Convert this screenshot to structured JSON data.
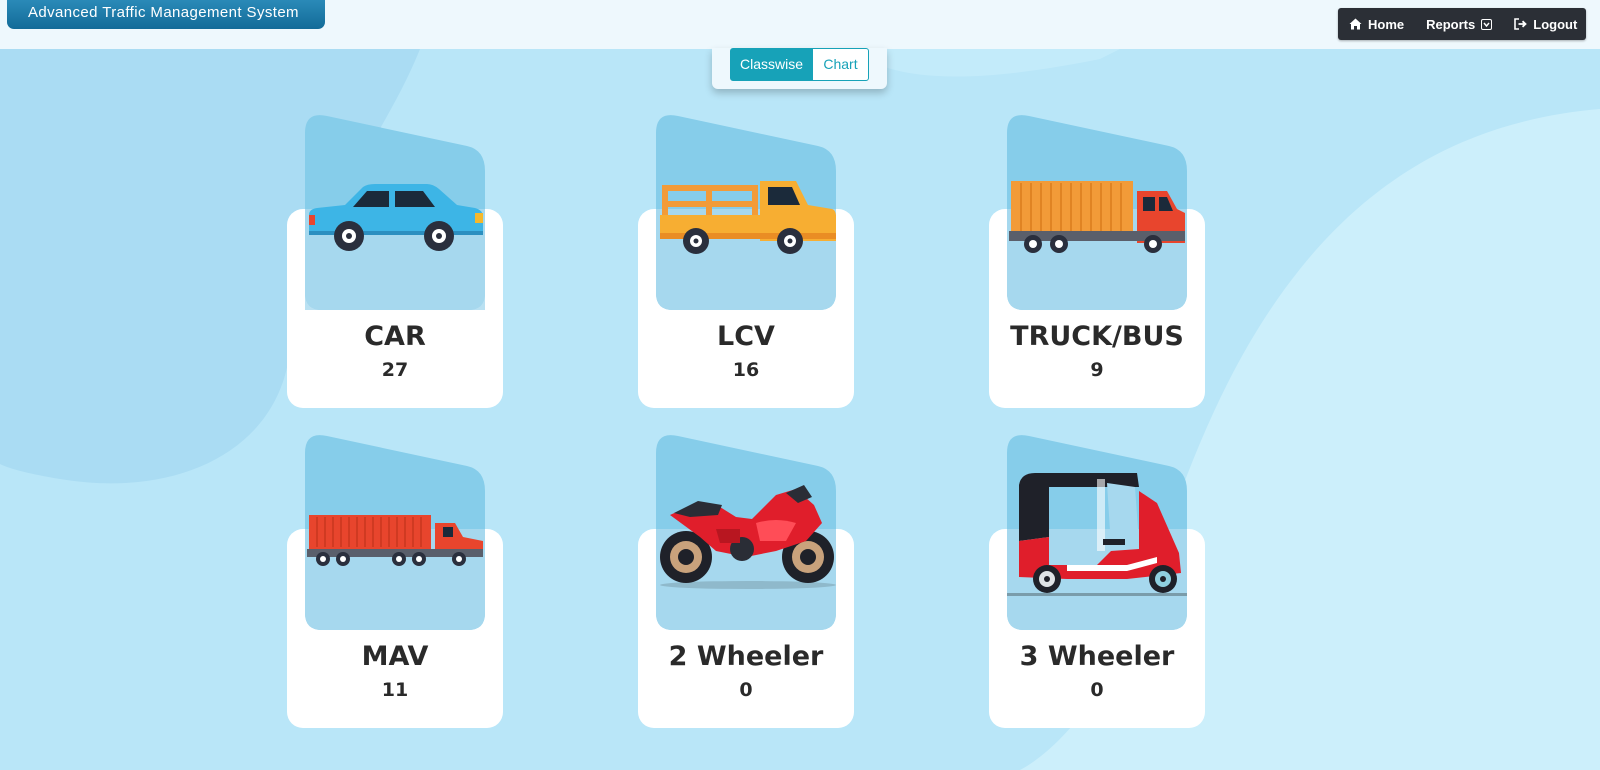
{
  "header": {
    "app_title": "Advanced Traffic Management System",
    "nav": {
      "home": "Home",
      "reports": "Reports",
      "logout": "Logout"
    }
  },
  "view_toggle": {
    "classwise": "Classwise",
    "chart": "Chart",
    "active": "Classwise"
  },
  "vehicle_classes": [
    {
      "label": "CAR",
      "count": "27",
      "icon": "car-icon"
    },
    {
      "label": "LCV",
      "count": "16",
      "icon": "pickup-truck-icon"
    },
    {
      "label": "TRUCK/BUS",
      "count": "9",
      "icon": "truck-icon"
    },
    {
      "label": "MAV",
      "count": "11",
      "icon": "trailer-truck-icon"
    },
    {
      "label": "2 Wheeler",
      "count": "0",
      "icon": "motorcycle-icon"
    },
    {
      "label": "3 Wheeler",
      "count": "0",
      "icon": "auto-rickshaw-icon"
    }
  ],
  "colors": {
    "background": "#b9e6f8",
    "accent": "#17a2b8",
    "title_bar": "#1a7bab",
    "navbar": "#2b2f36"
  }
}
